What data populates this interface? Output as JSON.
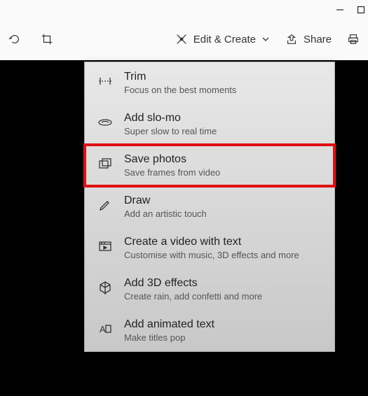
{
  "titlebar": {
    "minimize": "minimize",
    "maximize": "maximize"
  },
  "toolbar": {
    "rotate_label": "",
    "crop_label": "",
    "edit_create_label": "Edit & Create",
    "share_label": "Share",
    "print_label": ""
  },
  "menu": {
    "items": [
      {
        "title": "Trim",
        "subtitle": "Focus on the best moments",
        "icon": "trim-icon",
        "highlighted": false
      },
      {
        "title": "Add slo-mo",
        "subtitle": "Super slow to real time",
        "icon": "slomo-icon",
        "highlighted": false
      },
      {
        "title": "Save photos",
        "subtitle": "Save frames from video",
        "icon": "save-photos-icon",
        "highlighted": true
      },
      {
        "title": "Draw",
        "subtitle": "Add an artistic touch",
        "icon": "draw-icon",
        "highlighted": false
      },
      {
        "title": "Create a video with text",
        "subtitle": "Customise with music, 3D effects and more",
        "icon": "video-text-icon",
        "highlighted": false
      },
      {
        "title": "Add 3D effects",
        "subtitle": "Create rain, add confetti and more",
        "icon": "3d-effects-icon",
        "highlighted": false
      },
      {
        "title": "Add animated text",
        "subtitle": "Make titles pop",
        "icon": "animated-text-icon",
        "highlighted": false
      }
    ]
  }
}
